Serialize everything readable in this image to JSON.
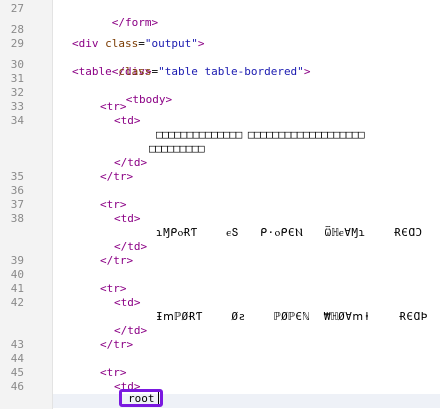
{
  "line_numbers": [
    "27",
    "28",
    "29",
    "30",
    "31",
    "32",
    "33",
    "34",
    "35",
    "36",
    "37",
    "38",
    "39",
    "40",
    "41",
    "42",
    "43",
    "44",
    "45",
    "46"
  ],
  "lines": {
    "l27": "</form>",
    "l29a": "<div ",
    "l29b": "class",
    "l29c": "=",
    "l29d": "\"output\"",
    "l29e": ">",
    "l30": "</div>",
    "l31a": "<table ",
    "l31b": "class",
    "l31c": "=",
    "l31d": "\"table table-bordered\"",
    "l31e": ">",
    "l32": "<tbody>",
    "tr_open": "<tr>",
    "td_open": "<td>",
    "td_close": "</td>",
    "tr_close": "</tr>",
    "row1_text_a": "□□□□□□□□□□□□□□ □□□□□□□□□□□□□□□□□□□",
    "row1_text_b": "□□□□□□□□□",
    "row2_text": "ɿⱮᑭⲟɌƬ    ⲉՏ   ᑭ⋅ⲟᑭЄⲚ   ѾℍⲉⱯⱮɿ    ɌЄⱭϽ",
    "row3_text": "ƗⅿℙØɌƬ    Øƨ    ℙØℙЄℕ  ₩ℍØⱯⅿⱡ    ɌЄⱭϷ",
    "cursor_text": "root"
  }
}
